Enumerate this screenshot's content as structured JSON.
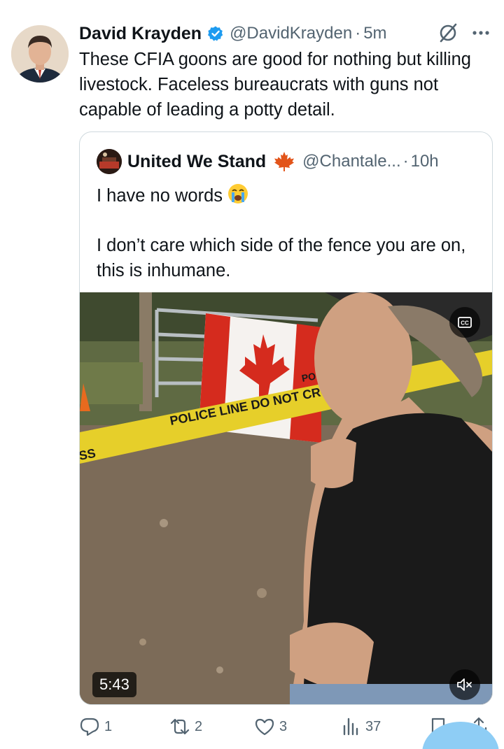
{
  "tweet": {
    "author_name": "David Krayden",
    "handle": "@DavidKrayden",
    "separator": "·",
    "time": "5m",
    "text": "These CFIA goons are good for nothing but killing livestock. Faceless bureaucrats with guns not capable of leading a potty detail."
  },
  "quote": {
    "author_name": "United We Stand",
    "handle": "@Chantale...",
    "separator": "·",
    "time": "10h",
    "text_line1": "I have no words",
    "text_line2": "I don’t care which side of the fence you are on, this is inhumane.",
    "video": {
      "duration": "5:43",
      "tape_text": "POLICE LINE DO NOT CROSS",
      "tape_text_2": "POLICE",
      "tape_edge_text": "SS"
    }
  },
  "actions": {
    "replies": "1",
    "reposts": "2",
    "likes": "3",
    "views": "37"
  },
  "colors": {
    "text": "#0f1419",
    "secondary": "#536471",
    "verified": "#1d9bf0",
    "border": "#cfd9de",
    "tape_yellow": "#e6cf2a",
    "flag_red": "#d52b1e"
  }
}
